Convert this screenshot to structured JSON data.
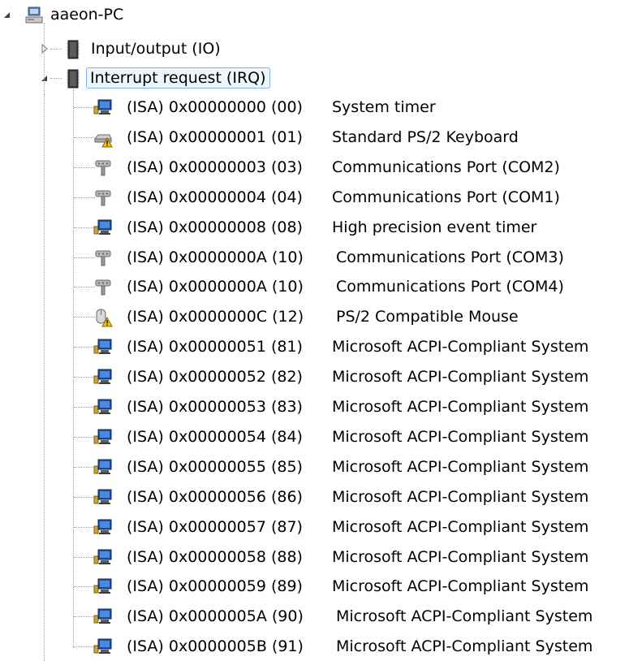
{
  "tree": {
    "root": {
      "label": "aaeon-PC",
      "icon": "computer-icon",
      "expanded": true
    },
    "categories": [
      {
        "label": "Input/output (IO)",
        "icon": "chip-icon",
        "expanded": false,
        "selected": false
      },
      {
        "label": "Interrupt request (IRQ)",
        "icon": "chip-icon",
        "expanded": true,
        "selected": true
      }
    ],
    "irq_items": [
      {
        "resource": "(ISA) 0x00000000 (00)",
        "device": "System timer",
        "icon": "system-device-icon"
      },
      {
        "resource": "(ISA) 0x00000001 (01)",
        "device": "Standard PS/2 Keyboard",
        "icon": "keyboard-warning-icon"
      },
      {
        "resource": "(ISA) 0x00000003 (03)",
        "device": "Communications Port (COM2)",
        "icon": "port-icon"
      },
      {
        "resource": "(ISA) 0x00000004 (04)",
        "device": "Communications Port (COM1)",
        "icon": "port-icon"
      },
      {
        "resource": "(ISA) 0x00000008 (08)",
        "device": "High precision event timer",
        "icon": "system-device-icon"
      },
      {
        "resource": "(ISA) 0x0000000A (10)",
        "device": "Communications Port (COM3)",
        "icon": "port-icon"
      },
      {
        "resource": "(ISA) 0x0000000A (10)",
        "device": "Communications Port (COM4)",
        "icon": "port-icon"
      },
      {
        "resource": "(ISA) 0x0000000C (12)",
        "device": "PS/2 Compatible Mouse",
        "icon": "mouse-warning-icon"
      },
      {
        "resource": "(ISA) 0x00000051 (81)",
        "device": "Microsoft ACPI-Compliant System",
        "icon": "system-device-icon"
      },
      {
        "resource": "(ISA) 0x00000052 (82)",
        "device": "Microsoft ACPI-Compliant System",
        "icon": "system-device-icon"
      },
      {
        "resource": "(ISA) 0x00000053 (83)",
        "device": "Microsoft ACPI-Compliant System",
        "icon": "system-device-icon"
      },
      {
        "resource": "(ISA) 0x00000054 (84)",
        "device": "Microsoft ACPI-Compliant System",
        "icon": "system-device-icon"
      },
      {
        "resource": "(ISA) 0x00000055 (85)",
        "device": "Microsoft ACPI-Compliant System",
        "icon": "system-device-icon"
      },
      {
        "resource": "(ISA) 0x00000056 (86)",
        "device": "Microsoft ACPI-Compliant System",
        "icon": "system-device-icon"
      },
      {
        "resource": "(ISA) 0x00000057 (87)",
        "device": "Microsoft ACPI-Compliant System",
        "icon": "system-device-icon"
      },
      {
        "resource": "(ISA) 0x00000058 (88)",
        "device": "Microsoft ACPI-Compliant System",
        "icon": "system-device-icon"
      },
      {
        "resource": "(ISA) 0x00000059 (89)",
        "device": "Microsoft ACPI-Compliant System",
        "icon": "system-device-icon"
      },
      {
        "resource": "(ISA) 0x0000005A (90)",
        "device": "Microsoft ACPI-Compliant System",
        "icon": "system-device-icon"
      },
      {
        "resource": "(ISA) 0x0000005B (91)",
        "device": "Microsoft ACPI-Compliant System",
        "icon": "system-device-icon"
      }
    ]
  },
  "colors": {
    "selection_fill": "#eef6fd",
    "selection_border": "#7eb4ea",
    "tree_line": "#a0a0a0",
    "text": "#000000"
  }
}
